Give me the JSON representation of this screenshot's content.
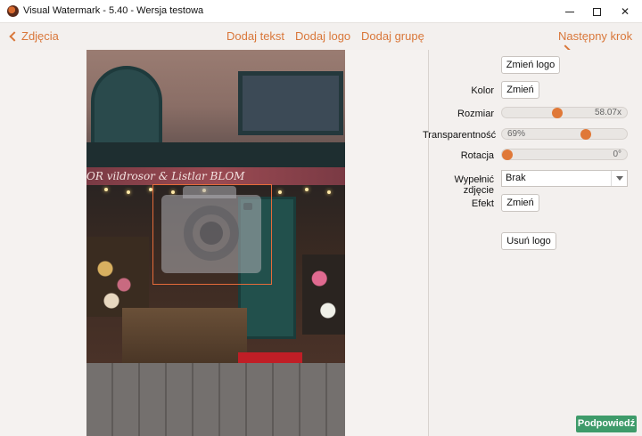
{
  "window": {
    "title": "Visual Watermark - 5.40 - Wersja testowa",
    "minimize_glyph": "minimize-icon",
    "maximize_glyph": "maximize-icon",
    "close_label": "✕"
  },
  "nav": {
    "prev_label": "Zdjęcia",
    "next_label": "Następny krok",
    "add_text": "Dodaj tekst",
    "add_logo": "Dodaj logo",
    "add_group": "Dodaj grupę"
  },
  "photo": {
    "sign_text": "OR  vildrosor & Listlar  BLOM"
  },
  "panel": {
    "change_logo": "Zmień logo",
    "color_label": "Kolor",
    "color_button": "Zmień",
    "size_label": "Rozmiar",
    "size_value": "58.07x",
    "size_fraction": 0.44,
    "transparency_label": "Transparentność",
    "transparency_value": "69%",
    "transparency_fraction": 0.69,
    "rotation_label": "Rotacja",
    "rotation_value": "0°",
    "rotation_fraction": 0.0,
    "fill_label": "Wypełnić zdjęcie",
    "fill_value": "Brak",
    "effect_label": "Efekt",
    "effect_button": "Zmień",
    "remove_logo": "Usuń logo"
  },
  "hint_button": "Podpowiedź",
  "colors": {
    "accent": "#e07837",
    "nav_link": "#d9773a",
    "hint_bg": "#3e9b6a"
  }
}
